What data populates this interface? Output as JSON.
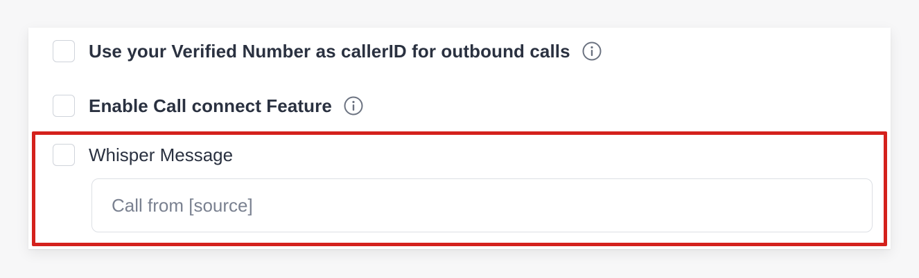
{
  "settings": {
    "options": [
      {
        "label": "Use your Verified Number as callerID for outbound calls",
        "checked": false,
        "has_info": true,
        "info_icon": "info-circle-icon"
      },
      {
        "label": "Enable Call connect Feature",
        "checked": false,
        "has_info": true,
        "info_icon": "info-circle-icon"
      },
      {
        "label": "Whisper Message",
        "checked": false,
        "has_info": false
      }
    ],
    "whisper_input": {
      "value": "",
      "placeholder": "Call from [source]"
    }
  },
  "colors": {
    "highlight_border": "#d4211c",
    "text": "#2a3140",
    "placeholder": "#7a8190",
    "checkbox_border": "#cfd3da"
  }
}
